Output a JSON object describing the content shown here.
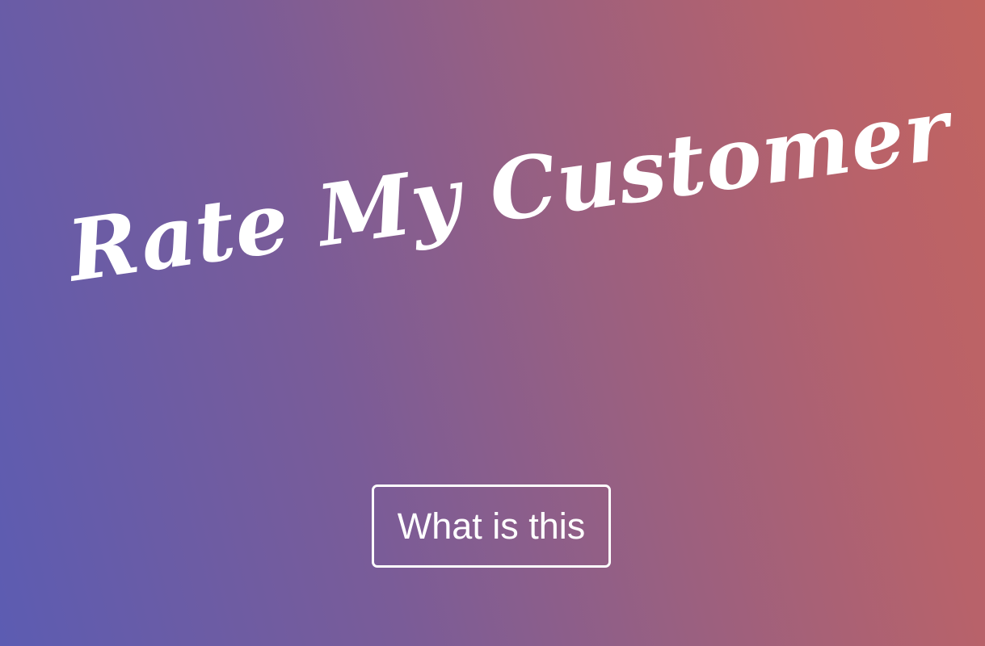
{
  "hero": {
    "title": "Rate My Customer",
    "cta_label": "What is this"
  },
  "colors": {
    "gradient_start": "#5c5cb2",
    "gradient_end": "#c26460",
    "text": "#ffffff"
  }
}
